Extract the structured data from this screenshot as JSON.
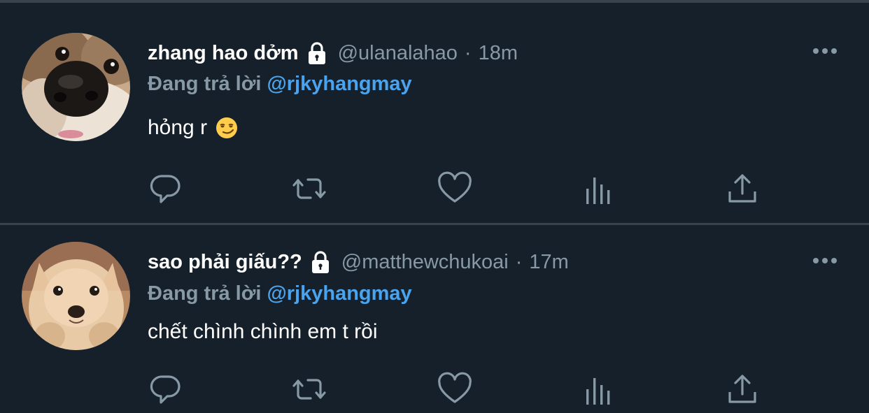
{
  "colors": {
    "background": "#15202b",
    "divider": "#38444d",
    "text_primary": "#ffffff",
    "text_secondary": "#8899a6",
    "accent": "#4aa3ec"
  },
  "tweets": [
    {
      "display_name": "zhang hao dởm",
      "handle": "@ulanalahao",
      "separator": "·",
      "time": "18m",
      "replying_prefix": "Đang trả lời",
      "replying_to": "@rjkyhangmay",
      "text": "hỏng r",
      "emoji": "smirk-emoji",
      "avatar": "dog-nose-closeup-avatar"
    },
    {
      "display_name": "sao phải giấu??",
      "handle": "@matthewchukoai",
      "separator": "·",
      "time": "17m",
      "replying_prefix": "Đang trả lời",
      "replying_to": "@rjkyhangmay",
      "text": "chết chình chình em t rồi",
      "emoji": null,
      "avatar": "chihuahua-avatar"
    }
  ],
  "icons": {
    "verified_lock": "lock-icon",
    "more": "more-options-icon",
    "reply": "reply-icon",
    "retweet": "retweet-icon",
    "like": "like-icon",
    "analytics": "analytics-icon",
    "share": "share-icon"
  }
}
